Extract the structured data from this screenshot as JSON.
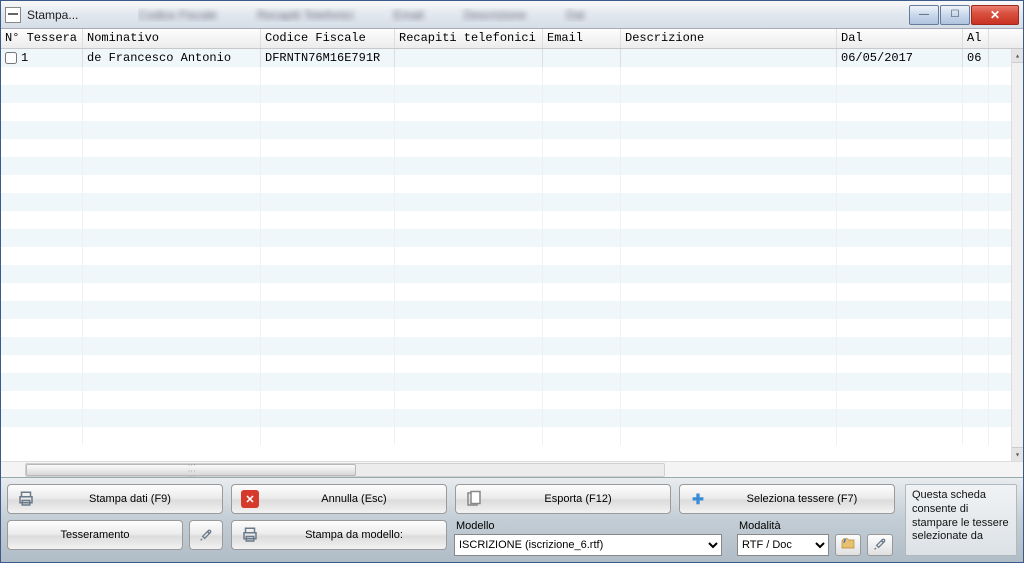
{
  "window": {
    "title": "Stampa..."
  },
  "columns": {
    "tessera": "N° Tessera",
    "nominativo": "Nominativo",
    "cf": "Codice Fiscale",
    "recapiti": "Recapiti telefonici",
    "email": "Email",
    "descrizione": "Descrizione",
    "dal": "Dal",
    "al": "Al"
  },
  "rows": [
    {
      "tessera": "1",
      "nominativo": "de Francesco Antonio",
      "cf": "DFRNTN76M16E791R",
      "recapiti": "",
      "email": "",
      "descrizione": "",
      "dal": "06/05/2017",
      "al": "06"
    }
  ],
  "buttons": {
    "stampa_dati": "Stampa dati (F9)",
    "annulla": "Annulla  (Esc)",
    "esporta": "Esporta (F12)",
    "seleziona": "Seleziona tessere (F7)",
    "tesseramento": "Tesseramento",
    "stampa_modello": "Stampa da modello:"
  },
  "fields": {
    "modello_label": "Modello",
    "modello_value": "ISCRIZIONE (iscrizione_6.rtf)",
    "modalita_label": "Modalità",
    "modalita_value": "RTF / Doc"
  },
  "help": "Questa scheda consente di stampare le tessere selezionate da"
}
